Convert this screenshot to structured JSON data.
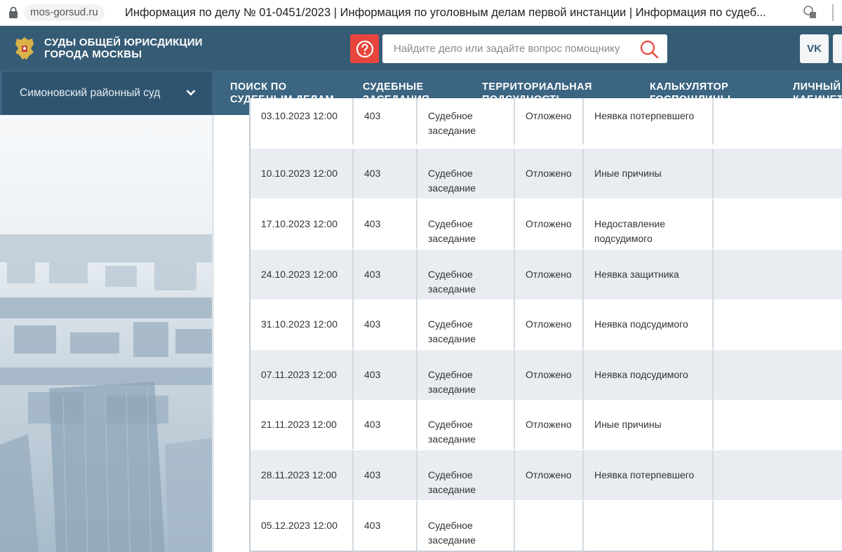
{
  "browser": {
    "domain": "mos-gorsud.ru",
    "title": "Информация по делу № 01-0451/2023 | Информация по уголовным делам первой инстанции | Информация по судеб..."
  },
  "header": {
    "site_name": "СУДЫ ОБЩЕЙ ЮРИСДИКЦИИ ГОРОДА МОСКВЫ",
    "search_placeholder": "Найдите дело или задайте вопрос помощнику",
    "social": "VK"
  },
  "nav": {
    "court": "Симоновский районный суд",
    "items": [
      {
        "line1": "ПОИСК ПО",
        "line2": "СУДЕБНЫМ ДЕЛАМ"
      },
      {
        "line1": "СУДЕБНЫЕ",
        "line2": "ЗАСЕДАНИЯ"
      },
      {
        "line1": "ТЕРРИТОРИАЛЬНАЯ",
        "line2": "ПОДСУДНОСТЬ"
      },
      {
        "line1": "КАЛЬКУЛЯТОР",
        "line2": "ГОСПОШЛИНЫ"
      },
      {
        "line1": "ЛИЧНЫЙ",
        "line2": "КАБИНЕТ"
      }
    ]
  },
  "hearings": {
    "rows": [
      {
        "datetime": "03.10.2023 12:00",
        "room": "403",
        "type1": "Судебное",
        "type2": "заседание",
        "result": "Отложено",
        "reason1": "Неявка потерпевшего",
        "reason2": ""
      },
      {
        "datetime": "10.10.2023 12:00",
        "room": "403",
        "type1": "Судебное",
        "type2": "заседание",
        "result": "Отложено",
        "reason1": "Иные причины",
        "reason2": ""
      },
      {
        "datetime": "17.10.2023 12:00",
        "room": "403",
        "type1": "Судебное",
        "type2": "заседание",
        "result": "Отложено",
        "reason1": "Недоставление",
        "reason2": "подсудимого"
      },
      {
        "datetime": "24.10.2023 12:00",
        "room": "403",
        "type1": "Судебное",
        "type2": "заседание",
        "result": "Отложено",
        "reason1": "Неявка защитника",
        "reason2": ""
      },
      {
        "datetime": "31.10.2023 12:00",
        "room": "403",
        "type1": "Судебное",
        "type2": "заседание",
        "result": "Отложено",
        "reason1": "Неявка подсудимого",
        "reason2": ""
      },
      {
        "datetime": "07.11.2023 12:00",
        "room": "403",
        "type1": "Судебное",
        "type2": "заседание",
        "result": "Отложено",
        "reason1": "Неявка подсудимого",
        "reason2": ""
      },
      {
        "datetime": "21.11.2023 12:00",
        "room": "403",
        "type1": "Судебное",
        "type2": "заседание",
        "result": "Отложено",
        "reason1": "Иные причины",
        "reason2": ""
      },
      {
        "datetime": "28.11.2023 12:00",
        "room": "403",
        "type1": "Судебное",
        "type2": "заседание",
        "result": "Отложено",
        "reason1": "Неявка потерпевшего",
        "reason2": ""
      },
      {
        "datetime": "05.12.2023 12:00",
        "room": "403",
        "type1": "Судебное",
        "type2": "заседание",
        "result": "",
        "reason1": "",
        "reason2": ""
      }
    ]
  },
  "colors": {
    "header_bg": "#355b75",
    "nav_bg": "#3b6581",
    "help_red": "#e8453c",
    "row_alt": "#e9ecf1"
  }
}
